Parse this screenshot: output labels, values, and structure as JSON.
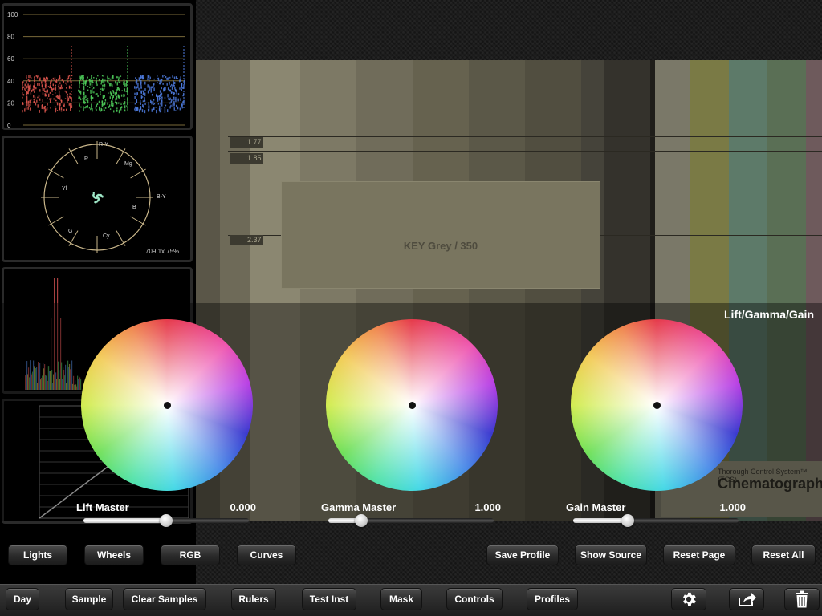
{
  "scopes": {
    "waveform": {
      "axis_labels": [
        "100",
        "80",
        "60",
        "40",
        "20",
        "0"
      ],
      "channel_colors": [
        "#e0574f",
        "#4fcf5c",
        "#4f7de0"
      ]
    },
    "vectorscope": {
      "targets": [
        "R-Y",
        "R",
        "Mg",
        "B-Y",
        "B",
        "Cy",
        "G",
        "Yl"
      ],
      "mode_label": "709 1x 75%"
    }
  },
  "viewer": {
    "chart_text": "KEY Grey / 350",
    "markers": [
      "1.77",
      "1.85",
      "2.37"
    ],
    "logo_small": "Thorough Control System™ (TCS)",
    "logo_big": "Cinematographer"
  },
  "mode_title": "Lift/Gamma/Gain",
  "wheels": [
    {
      "label": "Lift Master",
      "value": "0.000",
      "slider": 0.5
    },
    {
      "label": "Gamma Master",
      "value": "1.000",
      "slider": 0.2
    },
    {
      "label": "Gain Master",
      "value": "1.000",
      "slider": 0.33
    }
  ],
  "view_buttons": {
    "lights": "Lights",
    "wheels": "Wheels",
    "rgb": "RGB",
    "curves": "Curves"
  },
  "action_buttons": {
    "save_profile": "Save Profile",
    "show_source": "Show Source",
    "reset_page": "Reset Page",
    "reset_all": "Reset All"
  },
  "toolbar": {
    "day": "Day",
    "sample": "Sample",
    "clear_samples": "Clear Samples",
    "rulers": "Rulers",
    "test_inst": "Test Inst",
    "mask": "Mask",
    "controls": "Controls",
    "profiles": "Profiles",
    "icons": [
      "gear-icon",
      "share-icon",
      "trash-icon"
    ]
  }
}
